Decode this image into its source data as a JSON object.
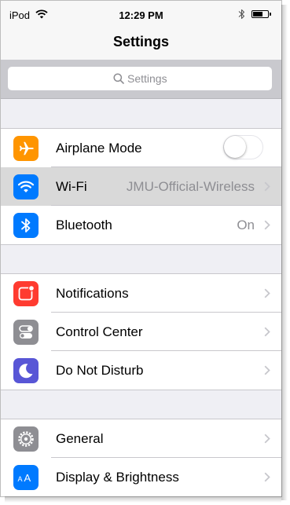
{
  "status_bar": {
    "carrier": "iPod",
    "time": "12:29 PM"
  },
  "nav": {
    "title": "Settings"
  },
  "search": {
    "placeholder": "Settings"
  },
  "groups": [
    {
      "rows": [
        {
          "label": "Airplane Mode",
          "icon": "airplane-icon",
          "icon_color": "#ff9500",
          "control": "toggle",
          "toggle_on": false
        },
        {
          "label": "Wi-Fi",
          "icon": "wifi-icon",
          "icon_color": "#007aff",
          "value": "JMU-Official-Wireless",
          "highlighted": true
        },
        {
          "label": "Bluetooth",
          "icon": "bluetooth-icon",
          "icon_color": "#007aff",
          "value": "On"
        }
      ]
    },
    {
      "rows": [
        {
          "label": "Notifications",
          "icon": "notifications-icon",
          "icon_color": "#ff3b30"
        },
        {
          "label": "Control Center",
          "icon": "control-center-icon",
          "icon_color": "#8e8e93"
        },
        {
          "label": "Do Not Disturb",
          "icon": "moon-icon",
          "icon_color": "#5856d6"
        }
      ]
    },
    {
      "rows": [
        {
          "label": "General",
          "icon": "gear-icon",
          "icon_color": "#8e8e93"
        },
        {
          "label": "Display & Brightness",
          "icon": "display-brightness-icon",
          "icon_color": "#007aff"
        }
      ]
    }
  ],
  "colors": {
    "background": "#efeff4",
    "chevron": "#c7c7cc",
    "secondary_text": "#8e8e93"
  }
}
